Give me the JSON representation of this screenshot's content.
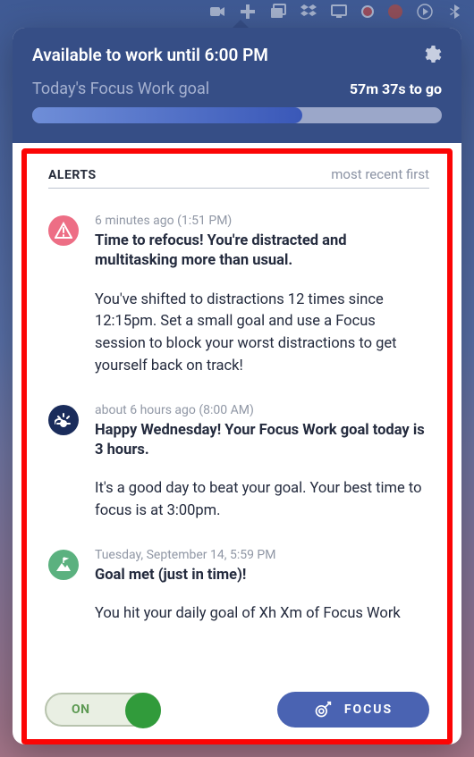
{
  "menubar_icons": [
    "video",
    "plus-medical",
    "windows-stack",
    "dropbox",
    "monitor",
    "bear-dot",
    "tomato",
    "play-circle",
    "bluetooth"
  ],
  "header": {
    "availability": "Available to work until 6:00 PM",
    "goal_label": "Today's Focus Work goal",
    "time_to_go": "57m 37s to go",
    "progress_pct": 66
  },
  "alerts_section": {
    "title": "ALERTS",
    "sort_label": "most recent first"
  },
  "alerts": [
    {
      "icon": "warning-icon",
      "color": "#ed6e85",
      "time": "6 minutes ago (1:51 PM)",
      "title": "Time to refocus! You're distracted and multitasking more than usual.",
      "body": "You've shifted to distractions 12 times since 12:15pm. Set a small goal and use a Focus session to block your worst distractions to get yourself back on track!"
    },
    {
      "icon": "sunrise-icon",
      "color": "#1a2c5b",
      "time": "about 6 hours ago (8:00 AM)",
      "title": "Happy Wednesday! Your Focus Work goal today is 3 hours.",
      "body": "It's a good day to beat your goal. Your best time to focus is at 3:00pm."
    },
    {
      "icon": "mountain-flag-icon",
      "color": "#5bb17f",
      "time": "Tuesday, September 14, 5:59 PM",
      "title": "Goal met (just in time)!",
      "body": "You hit your daily goal of Xh Xm of Focus Work"
    }
  ],
  "bottom": {
    "toggle_label": "ON",
    "focus_label": "FOCUS"
  }
}
